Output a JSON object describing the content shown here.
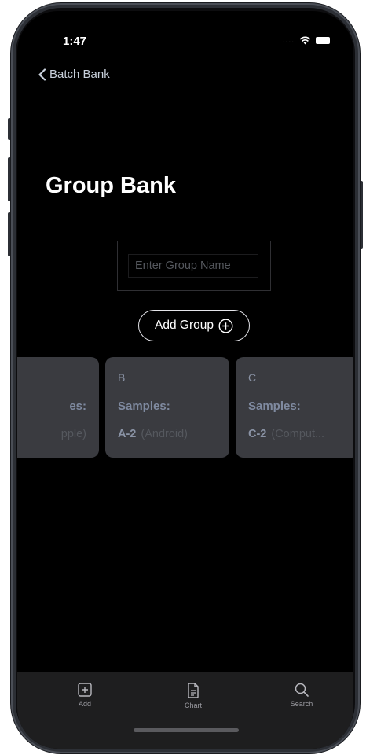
{
  "status_bar": {
    "time": "1:47",
    "signal": "...."
  },
  "nav": {
    "back_label": "Batch Bank"
  },
  "page": {
    "title": "Group Bank"
  },
  "group_name_input": {
    "placeholder": "Enter Group Name",
    "value": ""
  },
  "add_group_button": {
    "label": "Add Group"
  },
  "groups": [
    {
      "letter": "",
      "samples_label": "es:",
      "sample_id": "",
      "sample_desc": "pple)"
    },
    {
      "letter": "B",
      "samples_label": "Samples:",
      "sample_id": "A-2",
      "sample_desc": "(Android)"
    },
    {
      "letter": "C",
      "samples_label": "Samples:",
      "sample_id": "C-2",
      "sample_desc": "(Comput..."
    }
  ],
  "tab_bar": {
    "tabs": [
      {
        "label": "Add",
        "icon": "plus-square-icon"
      },
      {
        "label": "Chart",
        "icon": "document-icon"
      },
      {
        "label": "Search",
        "icon": "magnifier-icon"
      }
    ]
  },
  "colors": {
    "background": "#000000",
    "card": "#3a3b40",
    "tab_bar": "#1e1e1f",
    "accent_text": "#8a93a5"
  }
}
